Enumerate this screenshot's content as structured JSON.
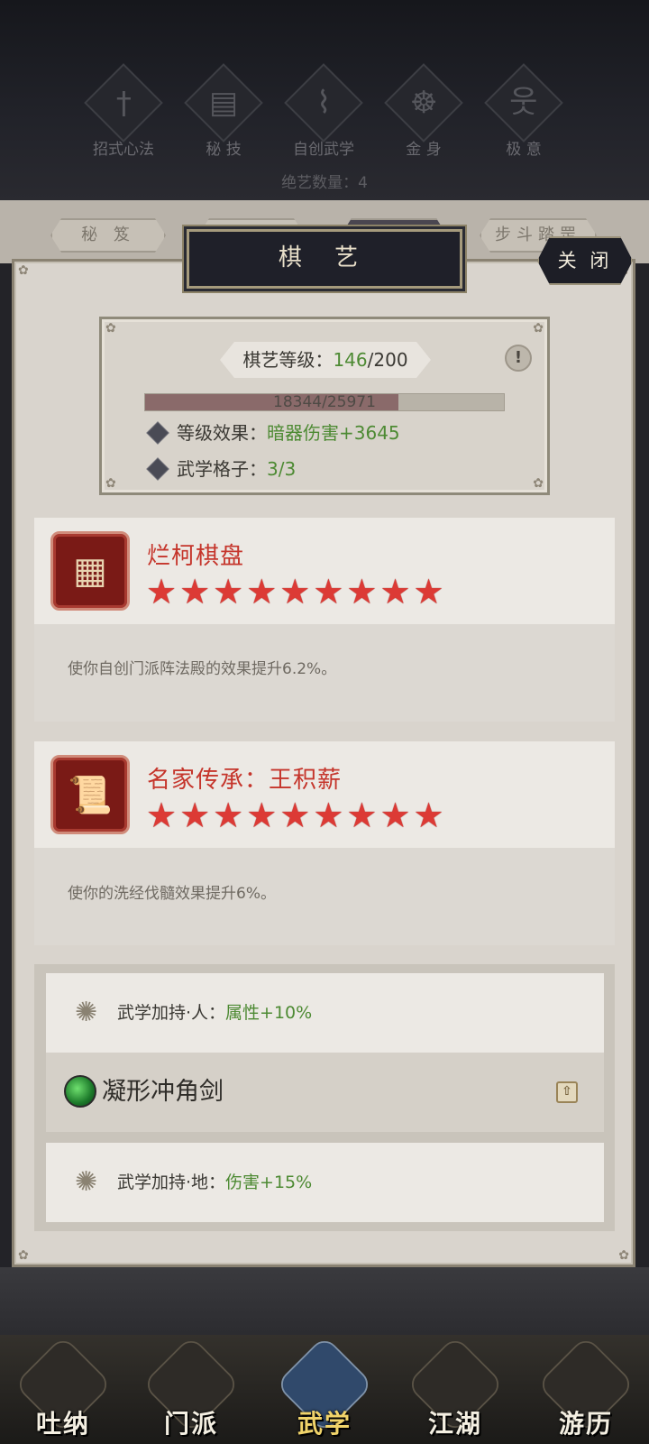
{
  "header": {
    "categories": [
      {
        "label": "招式心法",
        "icon": "sword-icon"
      },
      {
        "label": "秘 技",
        "icon": "book-icon"
      },
      {
        "label": "自创武学",
        "icon": "scroll-icon"
      },
      {
        "label": "金 身",
        "icon": "meditation-icon"
      },
      {
        "label": "极 意",
        "icon": "martial-pose-icon"
      }
    ],
    "juexi_count_text": "绝艺数量：4"
  },
  "bg_tabs": [
    "秘 笈",
    "",
    "",
    "步斗踏罡"
  ],
  "panel": {
    "title": "棋 艺",
    "close_label": "关 闭"
  },
  "level": {
    "label": "棋艺等级：",
    "current": "146",
    "max": "/200",
    "info_icon": "!",
    "exp_current": 18344,
    "exp_max": 25971,
    "exp_text": "18344/25971",
    "effect_label": "等级效果：",
    "effect_value": "暗器伤害+3645",
    "slots_label": "武学格子：",
    "slots_value": "3/3"
  },
  "cards": [
    {
      "name": "烂柯棋盘",
      "stars": "★★★★★★★★★",
      "star_count": 9,
      "desc": "使你自创门派阵法殿的效果提升6.2%。",
      "icon": "go-board-icon"
    },
    {
      "name": "名家传承：王积薪",
      "stars": "★★★★★★★★★",
      "star_count": 9,
      "desc": "使你的洗经伐髓效果提升6%。",
      "icon": "scroll-book-icon"
    }
  ],
  "bonuses": {
    "ren_label": "武学加持·人：",
    "ren_value": "属性+10%",
    "skill_name": "凝形冲角剑",
    "di_label": "武学加持·地：",
    "di_value": "伤害+15%"
  },
  "bottom_nav": [
    {
      "label": "吐纳",
      "active": false
    },
    {
      "label": "门派",
      "active": false
    },
    {
      "label": "武学",
      "active": true
    },
    {
      "label": "江湖",
      "active": false
    },
    {
      "label": "游历",
      "active": false
    }
  ],
  "colors": {
    "accent_red": "#c5352b",
    "value_green": "#4d8a33",
    "star_red": "#dc3a35"
  }
}
